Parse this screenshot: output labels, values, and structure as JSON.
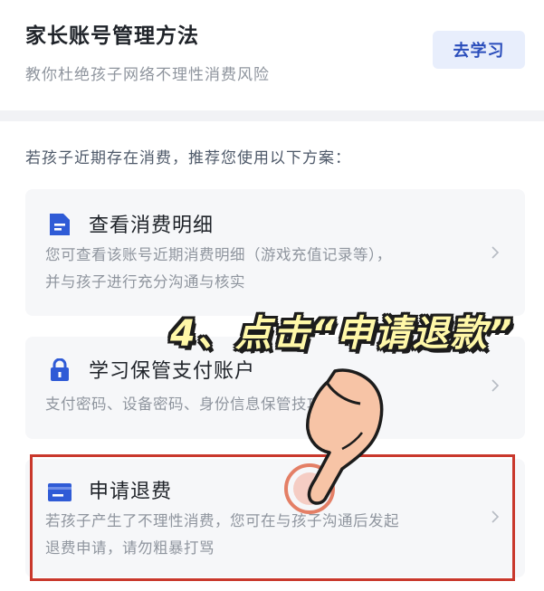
{
  "top": {
    "title": "家长账号管理方法",
    "subtitle": "教你杜绝孩子网络不理性消费风险",
    "learn_button": "去学习"
  },
  "intro": "若孩子近期存在消费，推荐您使用以下方案：",
  "cards": [
    {
      "icon": "document-icon",
      "title": "查看消费明细",
      "desc_line1": "您可查看该账号近期消费明细（游戏充值记录等），",
      "desc_line2": "并与孩子进行充分沟通与核实"
    },
    {
      "icon": "lock-icon",
      "title": "学习保管支付账户",
      "desc_line1": "支付密码、设备密码、身份信息保管技巧"
    },
    {
      "icon": "card-icon",
      "title": "申请退费",
      "desc_line1": "若孩子产生了不理性消费，您可在与孩子沟通后发起",
      "desc_line2": "退费申请，请勿粗暴打骂"
    }
  ],
  "overlay": {
    "step_text": "4、点击“申请退款”"
  },
  "colors": {
    "accent_blue": "#2f5bd6",
    "highlight_red": "#c9382c",
    "button_bg": "#e8eefc"
  }
}
